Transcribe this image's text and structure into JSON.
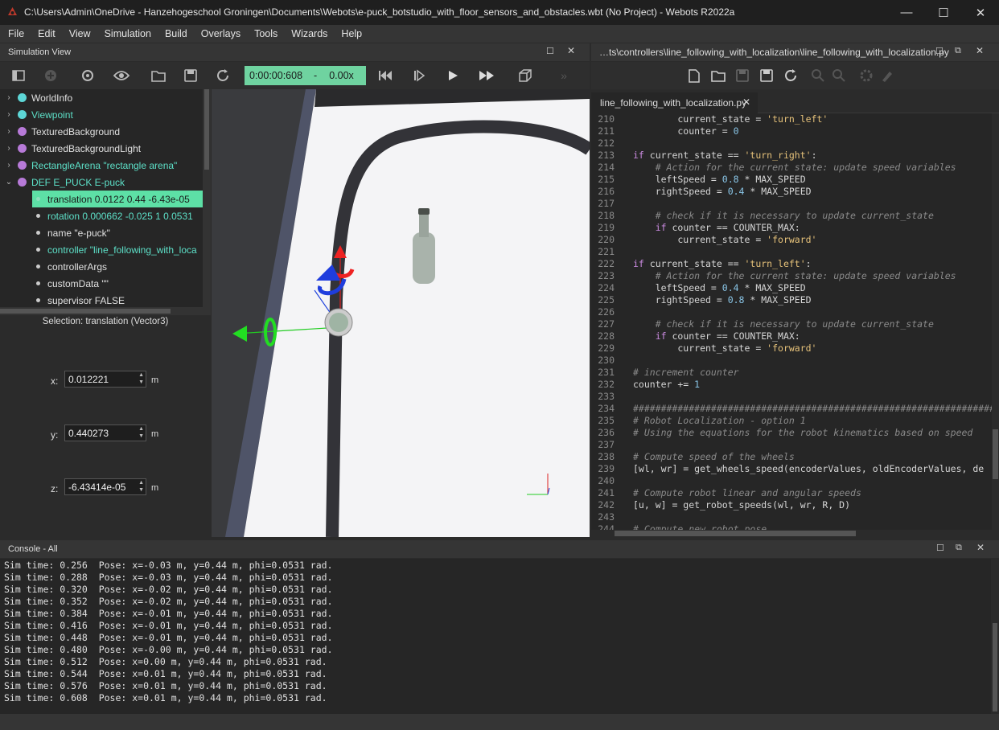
{
  "window": {
    "title": "C:\\Users\\Admin\\OneDrive - Hanzehogeschool Groningen\\Documents\\Webots\\e-puck_botstudio_with_floor_sensors_and_obstacles.wbt (No Project) - Webots R2022a",
    "minimize": "—",
    "maximize": "☐",
    "close": "✕"
  },
  "menu": [
    "File",
    "Edit",
    "View",
    "Simulation",
    "Build",
    "Overlays",
    "Tools",
    "Wizards",
    "Help"
  ],
  "simulation_view": {
    "title": "Simulation View",
    "time": "0:00:00:608",
    "sep": "-",
    "speed": "0.00x"
  },
  "scene_tree": {
    "nodes": [
      {
        "label": "WorldInfo",
        "color": "#5dd6d6",
        "highlight": false
      },
      {
        "label": "Viewpoint",
        "color": "#5dd6d6",
        "highlight": true
      },
      {
        "label": "TexturedBackground",
        "color": "#b77ad8",
        "highlight": false
      },
      {
        "label": "TexturedBackgroundLight",
        "color": "#b77ad8",
        "highlight": false
      },
      {
        "label": "RectangleArena \"rectangle arena\"",
        "color": "#b77ad8",
        "highlight": true
      },
      {
        "label": "DEF E_PUCK E-puck",
        "color": "#b77ad8",
        "highlight": true
      }
    ],
    "fields": [
      {
        "label": "translation 0.0122 0.44 -6.43e-05",
        "selected": true,
        "highlight": false
      },
      {
        "label": "rotation 0.000662 -0.025 1 0.0531",
        "selected": false,
        "highlight": true
      },
      {
        "label": "name \"e-puck\"",
        "selected": false,
        "highlight": false
      },
      {
        "label": "controller \"line_following_with_loca",
        "selected": false,
        "highlight": true
      },
      {
        "label": "controllerArgs",
        "selected": false,
        "highlight": false
      },
      {
        "label": "customData \"\"",
        "selected": false,
        "highlight": false
      },
      {
        "label": "supervisor FALSE",
        "selected": false,
        "highlight": false
      }
    ]
  },
  "field_editor": {
    "selection": "Selection: translation (Vector3)",
    "x_label": "x:",
    "x_value": "0.012221",
    "y_label": "y:",
    "y_value": "0.440273",
    "z_label": "z:",
    "z_value": "-6.43414e-05",
    "unit": "m"
  },
  "text_editor": {
    "path": "…ts\\controllers\\line_following_with_localization\\line_following_with_localization.py",
    "tab": "line_following_with_localization.py",
    "lines": [
      {
        "n": "210",
        "t": "        current_state = 'turn_left'"
      },
      {
        "n": "211",
        "t": "        counter = 0"
      },
      {
        "n": "212",
        "t": ""
      },
      {
        "n": "213",
        "t": "if current_state == 'turn_right':"
      },
      {
        "n": "214",
        "t": "    # Action for the current state: update speed variables"
      },
      {
        "n": "215",
        "t": "    leftSpeed = 0.8 * MAX_SPEED"
      },
      {
        "n": "216",
        "t": "    rightSpeed = 0.4 * MAX_SPEED"
      },
      {
        "n": "217",
        "t": ""
      },
      {
        "n": "218",
        "t": "    # check if it is necessary to update current_state"
      },
      {
        "n": "219",
        "t": "    if counter == COUNTER_MAX:"
      },
      {
        "n": "220",
        "t": "        current_state = 'forward'"
      },
      {
        "n": "221",
        "t": ""
      },
      {
        "n": "222",
        "t": "if current_state == 'turn_left':"
      },
      {
        "n": "223",
        "t": "    # Action for the current state: update speed variables"
      },
      {
        "n": "224",
        "t": "    leftSpeed = 0.4 * MAX_SPEED"
      },
      {
        "n": "225",
        "t": "    rightSpeed = 0.8 * MAX_SPEED"
      },
      {
        "n": "226",
        "t": ""
      },
      {
        "n": "227",
        "t": "    # check if it is necessary to update current_state"
      },
      {
        "n": "228",
        "t": "    if counter == COUNTER_MAX:"
      },
      {
        "n": "229",
        "t": "        current_state = 'forward'"
      },
      {
        "n": "230",
        "t": ""
      },
      {
        "n": "231",
        "t": "# increment counter"
      },
      {
        "n": "232",
        "t": "counter += 1"
      },
      {
        "n": "233",
        "t": ""
      },
      {
        "n": "234",
        "t": "##################################################################"
      },
      {
        "n": "235",
        "t": "# Robot Localization - option 1"
      },
      {
        "n": "236",
        "t": "# Using the equations for the robot kinematics based on speed"
      },
      {
        "n": "237",
        "t": ""
      },
      {
        "n": "238",
        "t": "# Compute speed of the wheels"
      },
      {
        "n": "239",
        "t": "[wl, wr] = get_wheels_speed(encoderValues, oldEncoderValues, de"
      },
      {
        "n": "240",
        "t": ""
      },
      {
        "n": "241",
        "t": "# Compute robot linear and angular speeds"
      },
      {
        "n": "242",
        "t": "[u, w] = get_robot_speeds(wl, wr, R, D)"
      },
      {
        "n": "243",
        "t": ""
      },
      {
        "n": "244",
        "t": "# Compute new robot pose"
      }
    ]
  },
  "console": {
    "title": "Console - All",
    "lines": [
      "Sim time: 0.256  Pose: x=-0.03 m, y=0.44 m, phi=0.0531 rad.",
      "Sim time: 0.288  Pose: x=-0.03 m, y=0.44 m, phi=0.0531 rad.",
      "Sim time: 0.320  Pose: x=-0.02 m, y=0.44 m, phi=0.0531 rad.",
      "Sim time: 0.352  Pose: x=-0.02 m, y=0.44 m, phi=0.0531 rad.",
      "Sim time: 0.384  Pose: x=-0.01 m, y=0.44 m, phi=0.0531 rad.",
      "Sim time: 0.416  Pose: x=-0.01 m, y=0.44 m, phi=0.0531 rad.",
      "Sim time: 0.448  Pose: x=-0.01 m, y=0.44 m, phi=0.0531 rad.",
      "Sim time: 0.480  Pose: x=-0.00 m, y=0.44 m, phi=0.0531 rad.",
      "Sim time: 0.512  Pose: x=0.00 m, y=0.44 m, phi=0.0531 rad.",
      "Sim time: 0.544  Pose: x=0.01 m, y=0.44 m, phi=0.0531 rad.",
      "Sim time: 0.576  Pose: x=0.01 m, y=0.44 m, phi=0.0531 rad.",
      "Sim time: 0.608  Pose: x=0.01 m, y=0.44 m, phi=0.0531 rad."
    ]
  },
  "colors": {
    "accent_green": "#5de0a6",
    "highlight_cyan": "#5de0c8",
    "string": "#e6c27a",
    "number": "#8ac6e8",
    "keyword": "#c98adf",
    "comment": "#8a8a8a"
  }
}
